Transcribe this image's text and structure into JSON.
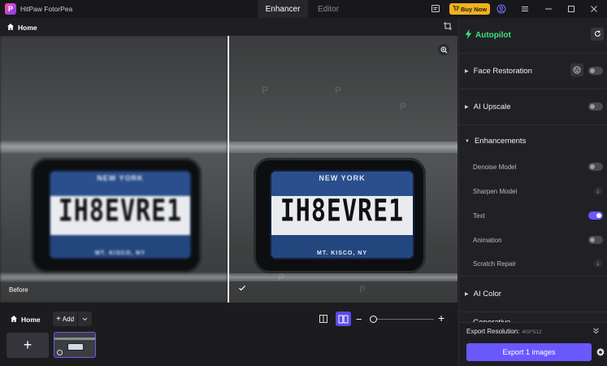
{
  "app": {
    "title": "HitPaw FotorPea",
    "logo_letter": "P"
  },
  "tabs": [
    {
      "label": "Enhancer",
      "active": true
    },
    {
      "label": "Editor",
      "active": false
    }
  ],
  "titlebar": {
    "buy_label": "Buy Now"
  },
  "workspace": {
    "breadcrumb": "Home",
    "before_label": "Before",
    "plate": {
      "state": "NEW YORK",
      "number": "IH8EVRE1",
      "county": "MT. KISCO, NY"
    }
  },
  "bottombar": {
    "home_label": "Home",
    "add_label": "Add"
  },
  "panel": {
    "autopilot_label": "Autopilot",
    "sections": {
      "face_restoration": "Face Restoration",
      "ai_upscale": "AI Upscale",
      "enhancements": "Enhancements",
      "ai_color": "AI Color",
      "generative": "Generative"
    },
    "enhancement_items": {
      "denoise": "Denoise Model",
      "sharpen": "Sharpen Model",
      "text": "Text",
      "animation": "Animation",
      "scratch": "Scratch Repair"
    },
    "export_resolution_label": "Export Resolution:",
    "export_resolution_value": "400*512",
    "export_button": "Export 1 images"
  },
  "colors": {
    "accent": "#6a58ff",
    "autopilot": "#3ee27a",
    "buy": "#f1b21d"
  }
}
